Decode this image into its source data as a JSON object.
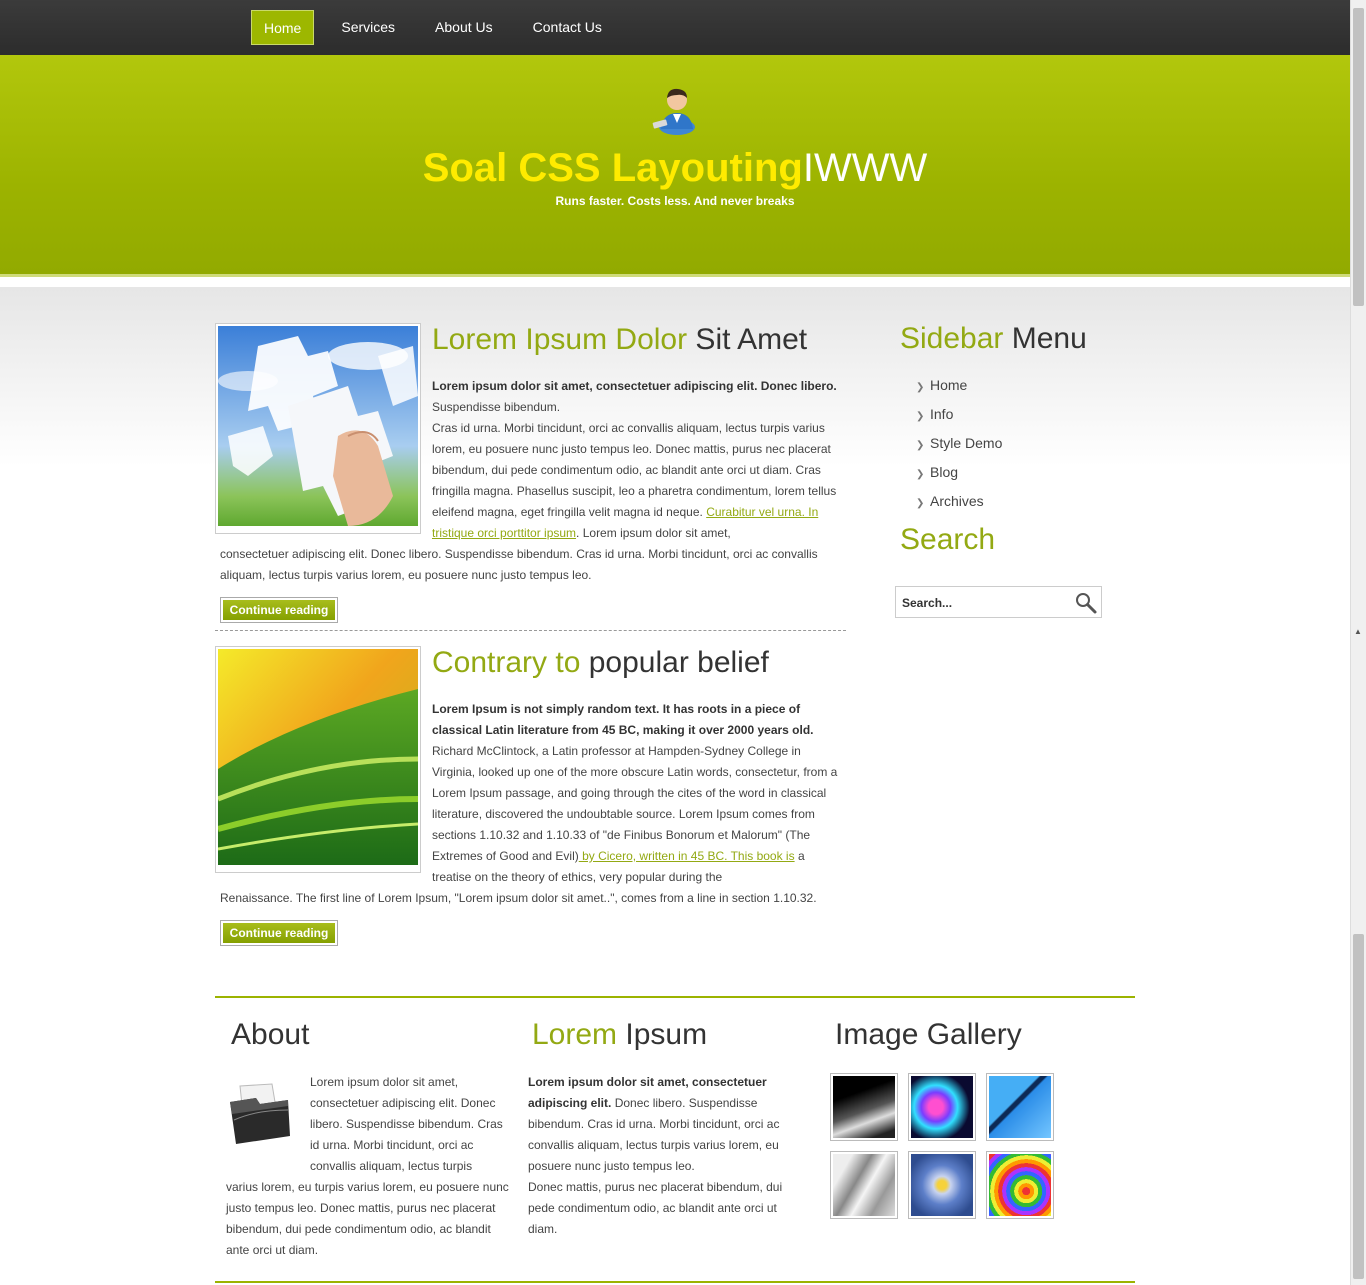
{
  "nav": {
    "items": [
      {
        "label": "Home"
      },
      {
        "label": "Services"
      },
      {
        "label": "About Us"
      },
      {
        "label": "Contact Us"
      }
    ]
  },
  "header": {
    "title_yellow": "Soal CSS Layouting",
    "title_white": "IWWW",
    "tagline": "Runs faster. Costs less. And never breaks"
  },
  "posts": [
    {
      "title_green": "Lorem Ipsum Dolor",
      "title_dark": " Sit Amet",
      "lead": "Lorem ipsum dolor sit amet, consectetuer adipiscing elit. Donec libero.",
      "text1": "Suspendisse bibendum.",
      "text2": "Cras id urna. Morbi tincidunt, orci ac convallis aliquam, lectus turpis varius lorem, eu posuere nunc justo tempus leo. Donec mattis, purus nec placerat bibendum, dui pede condimentum odio, ac blandit ante orci ut diam. Cras fringilla magna. Phasellus suscipit, leo a pharetra condimentum, lorem tellus eleifend magna, eget fringilla velit magna id neque. ",
      "link": "Curabitur vel urna. In tristique orci porttitor ipsum",
      "text3": ". Lorem ipsum dolor sit amet,",
      "text4": "consectetuer adipiscing elit. Donec libero. Suspendisse bibendum. Cras id urna. Morbi tincidunt, orci ac convallis aliquam, lectus turpis varius lorem, eu posuere nunc justo tempus leo.",
      "button": "Continue reading"
    },
    {
      "title_green": "Contrary to",
      "title_dark": " popular belief",
      "lead": "Lorem Ipsum is not simply random text. It has roots in a piece of classical Latin literature from 45 BC, making it over 2000 years old.",
      "text1": "Richard McClintock, a Latin professor at Hampden-Sydney College in Virginia, looked up one of the more obscure Latin words, consectetur, from a Lorem Ipsum passage, and going through the cites of the word in classical literature, discovered the undoubtable source. Lorem Ipsum comes from sections 1.10.32 and 1.10.33 of \"de Finibus Bonorum et Malorum\" (The Extremes of Good and Evil)",
      "link": " by Cicero, written in 45 BC. This book is",
      "text2": " a treatise on the theory of ethics, very popular during the",
      "text3": "Renaissance. The first line of Lorem Ipsum, \"Lorem ipsum dolor sit amet..\", comes from a line in section 1.10.32.",
      "button": "Continue reading"
    }
  ],
  "sidebar": {
    "menu_title_green": "Sidebar",
    "menu_title_dark": " Menu",
    "items": [
      {
        "label": "Home"
      },
      {
        "label": "Info"
      },
      {
        "label": "Style Demo"
      },
      {
        "label": "Blog"
      },
      {
        "label": "Archives"
      }
    ],
    "search_title": "Search",
    "search_placeholder": "Search..."
  },
  "footer": {
    "about": {
      "title": "About",
      "text_a": "Lorem ipsum dolor sit amet, consectetuer adipiscing elit. Donec libero. Suspendisse bibendum. Cras id urna. Morbi tincidunt, orci ac convallis aliquam, lectus turpis",
      "text_b": "varius lorem, eu turpis varius lorem, eu posuere nunc justo tempus leo. Donec mattis, purus nec placerat bibendum, dui pede condimentum odio, ac blandit ante orci ut diam."
    },
    "lorem": {
      "title_green": "Lorem",
      "title_dark": " Ipsum",
      "lead": "Lorem ipsum dolor sit amet, consectetuer adipiscing elit.",
      "text1": " Donec libero. Suspendisse bibendum. Cras id urna. Morbi tincidunt, orci ac convallis aliquam, lectus turpis varius lorem, eu posuere nunc justo tempus leo.",
      "text2": "Donec mattis, purus nec placerat bibendum, dui pede condimentum odio, ac blandit ante orci ut diam."
    },
    "gallery": {
      "title": "Image Gallery"
    }
  },
  "colors": {
    "accent": "#93a913",
    "header_bg": "#9cb300",
    "title_yellow": "#ffeb00",
    "nav_bg": "#333333"
  }
}
